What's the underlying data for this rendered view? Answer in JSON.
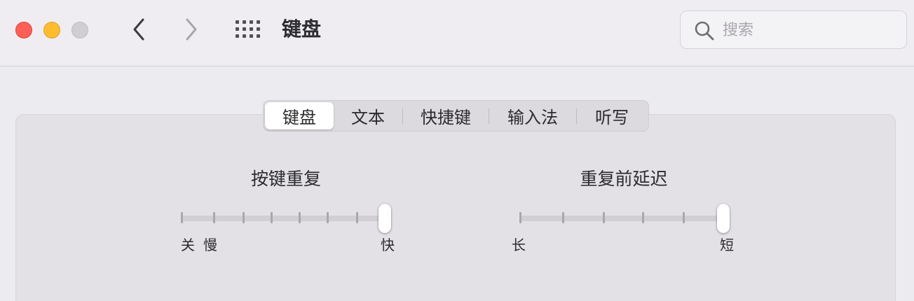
{
  "window": {
    "title": "键盘"
  },
  "toolbar": {
    "back_icon": "chevron-left-icon",
    "forward_icon": "chevron-right-icon",
    "show_all_icon": "grid-icon"
  },
  "search": {
    "placeholder": "搜索",
    "value": ""
  },
  "tabs": [
    {
      "label": "键盘",
      "selected": true
    },
    {
      "label": "文本",
      "selected": false
    },
    {
      "label": "快捷键",
      "selected": false
    },
    {
      "label": "输入法",
      "selected": false
    },
    {
      "label": "听写",
      "selected": false
    }
  ],
  "key_repeat": {
    "title": "按键重复",
    "min_label": "关",
    "slow_label": "慢",
    "max_label": "快",
    "tick_count": 8,
    "level": 1.0
  },
  "delay_until_repeat": {
    "title": "重复前延迟",
    "min_label": "长",
    "max_label": "短",
    "tick_count": 6,
    "level": 1.0
  },
  "colors": {
    "close": "#fe5f57",
    "minimize": "#febc2e",
    "zoom_disabled": "#cfced3"
  }
}
